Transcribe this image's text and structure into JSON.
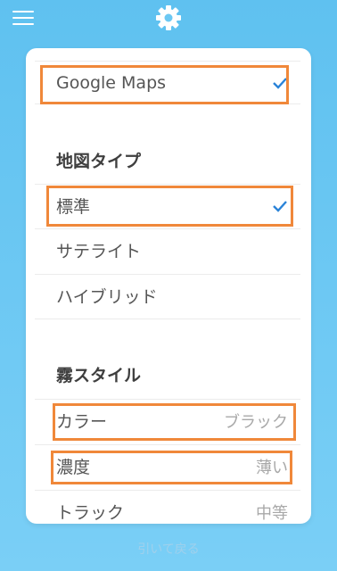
{
  "header": {
    "menu_icon": "hamburger-menu-icon",
    "settings_icon": "gear-icon"
  },
  "map_provider": {
    "selected_label": "Google Maps",
    "check_icon": "checkmark-icon"
  },
  "map_type": {
    "header": "地図タイプ",
    "items": [
      {
        "label": "標準",
        "selected": true
      },
      {
        "label": "サテライト",
        "selected": false
      },
      {
        "label": "ハイブリッド",
        "selected": false
      }
    ]
  },
  "fog_style": {
    "header": "霧スタイル",
    "items": [
      {
        "label": "カラー",
        "value": "ブラック"
      },
      {
        "label": "濃度",
        "value": "薄い"
      },
      {
        "label": "トラック",
        "value": "中等"
      }
    ]
  },
  "footer": {
    "hint": "引いて戻る"
  },
  "colors": {
    "background": "#6cc8f3",
    "highlight": "#f0883a",
    "check": "#2a83d8"
  }
}
